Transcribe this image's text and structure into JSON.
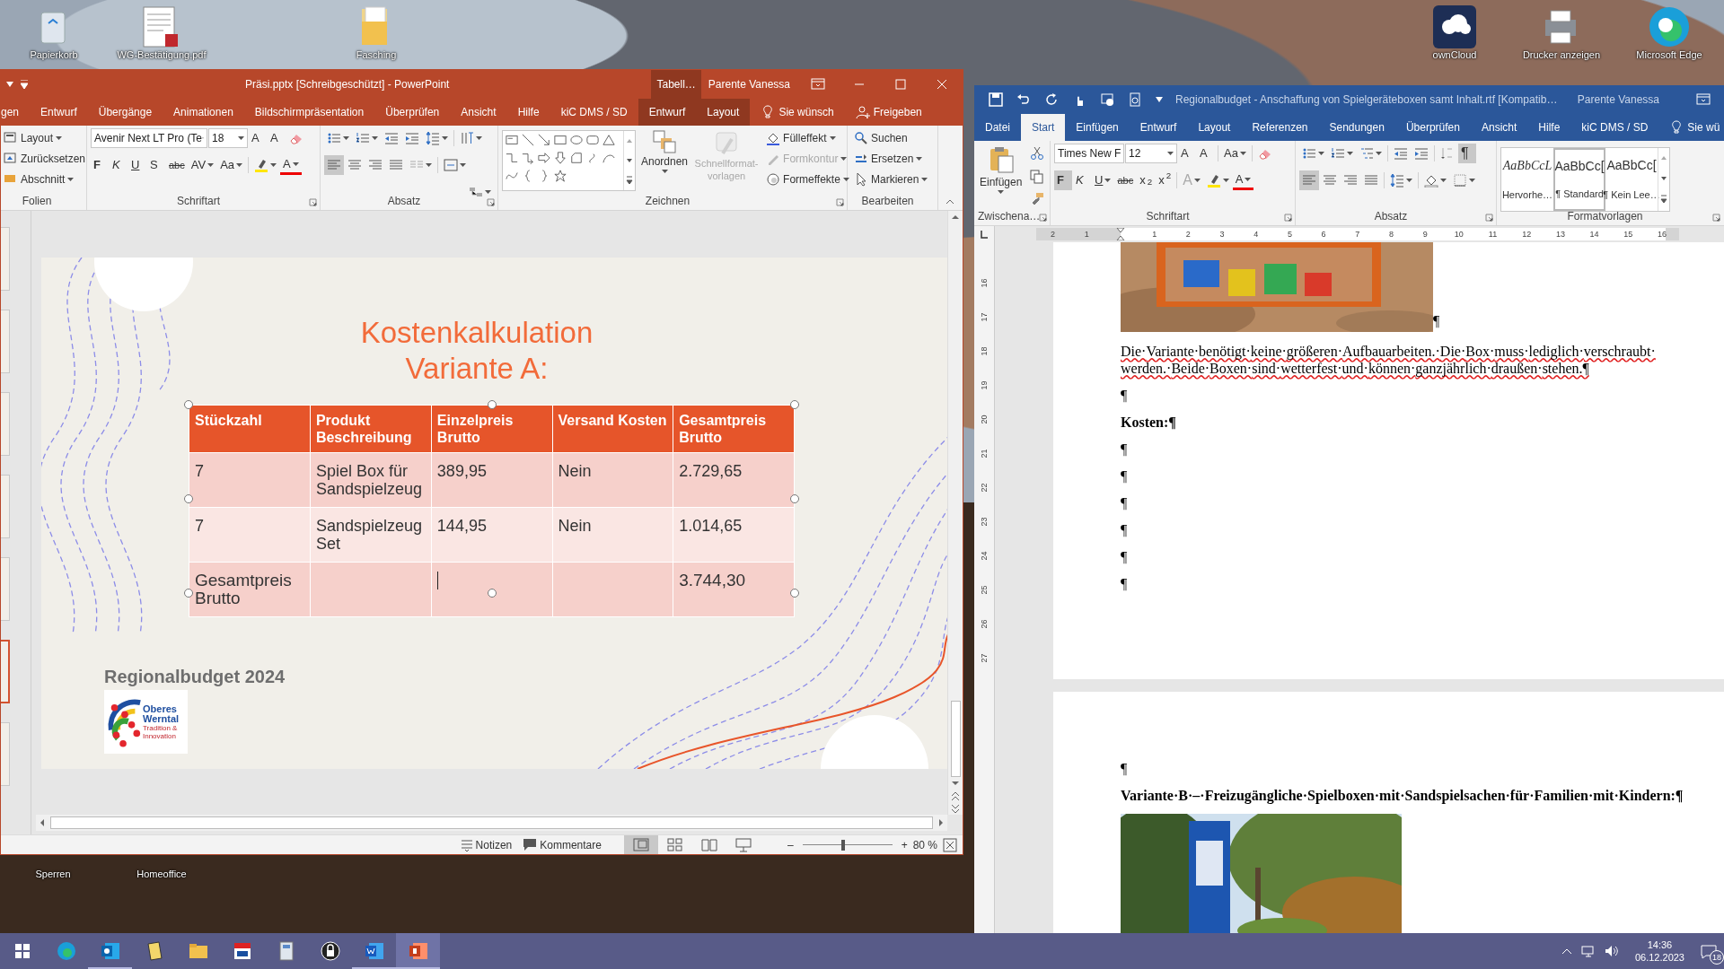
{
  "desktop": {
    "icons": [
      {
        "label": "Papierkorb"
      },
      {
        "label": "WG-Bestätigung.pdf"
      },
      {
        "label": "Fasching"
      },
      {
        "label": "ownCloud"
      },
      {
        "label": "Drucker anzeigen"
      },
      {
        "label": "Microsoft Edge"
      },
      {
        "label": "Sperren"
      },
      {
        "label": "Homeoffice"
      }
    ]
  },
  "powerpoint": {
    "title": "Präsi.pptx [Schreibgeschützt]  -  PowerPoint",
    "context_group": "Tabell…",
    "user": "Parente Vanessa",
    "tabs": [
      {
        "label": "gen",
        "kind": "main",
        "selected": false
      },
      {
        "label": "Entwurf",
        "kind": "main",
        "selected": false
      },
      {
        "label": "Übergänge",
        "kind": "main",
        "selected": false
      },
      {
        "label": "Animationen",
        "kind": "main",
        "selected": false
      },
      {
        "label": "Bildschirmpräsentation",
        "kind": "main",
        "selected": false
      },
      {
        "label": "Überprüfen",
        "kind": "main",
        "selected": false
      },
      {
        "label": "Ansicht",
        "kind": "main",
        "selected": false
      },
      {
        "label": "Hilfe",
        "kind": "main",
        "selected": false
      },
      {
        "label": "kiC DMS / SD",
        "kind": "main",
        "selected": false
      },
      {
        "label": "Entwurf",
        "kind": "context",
        "selected": false
      },
      {
        "label": "Layout",
        "kind": "context",
        "selected": false
      }
    ],
    "tell_me": "Sie wünsch",
    "share": "Freigeben",
    "ribbon": {
      "slides": {
        "label": "Folien",
        "layout": "Layout",
        "reset": "Zurücksetzen",
        "section": "Abschnitt"
      },
      "font": {
        "label": "Schriftart",
        "font_name": "Avenir Next LT Pro (Te",
        "font_size": "18",
        "grow": "A",
        "shrink": "A",
        "format": [
          "F",
          "K",
          "U",
          "S",
          "abc",
          "AV",
          "Aa"
        ],
        "font_color": "A"
      },
      "paragraph": {
        "label": "Absatz",
        "alignment": [
          {
            "selected": true
          },
          {
            "selected": false
          },
          {
            "selected": false
          },
          {
            "selected": false
          }
        ]
      },
      "drawing": {
        "label": "Zeichnen",
        "arrange": "Anordnen",
        "quick_styles": {
          "label": "Schnellformat-vorlagen",
          "disabled": true
        },
        "fill": {
          "label": "Fülleffekt",
          "disabled": false
        },
        "outline": {
          "label": "Formkontur",
          "disabled": true
        },
        "effects": {
          "label": "Formeffekte",
          "disabled": false
        }
      },
      "editing": {
        "label": "Bearbeiten",
        "find": "Suchen",
        "replace": "Ersetzen",
        "select": "Markieren"
      }
    },
    "thumbnails": [
      {
        "selected": false
      },
      {
        "selected": false
      },
      {
        "selected": false
      },
      {
        "selected": false
      },
      {
        "selected": false
      },
      {
        "selected": true
      },
      {
        "selected": false
      }
    ],
    "slide": {
      "title": "Kostenkalkulation Variante A:",
      "table": {
        "selected": true,
        "columns": [
          "Stückzahl",
          "Produkt Beschreibung",
          "Einzelpreis Brutto",
          "Versand Kosten",
          "Gesamtpreis Brutto"
        ],
        "rows": [
          [
            "7",
            "Spiel Box für Sandspielzeug",
            "389,95",
            "Nein",
            "2.729,65"
          ],
          [
            "7",
            "Sandspielzeug Set",
            "144,95",
            "Nein",
            "1.014,65"
          ],
          [
            "Gesamtpreis Brutto",
            null,
            {
              "cursor": true
            },
            null,
            "3.744,30"
          ]
        ]
      },
      "footer": "Regionalbudget 2024",
      "logo": {
        "line1": "Oberes",
        "line2": "Werntal",
        "tagline": "Tradition & Innovation"
      }
    },
    "status_bar": {
      "notes": "Notizen",
      "comments": "Kommentare",
      "views": [
        {
          "selected": true
        },
        {
          "selected": false
        },
        {
          "selected": false
        },
        {
          "selected": false
        }
      ],
      "zoom_out": "–",
      "zoom": {
        "level": 0.45
      },
      "zoom_in": "+",
      "zoom_label": "80 %"
    }
  },
  "word": {
    "title": "Regionalbudget - Anschaffung von Spielgeräteboxen samt Inhalt.rtf [Kompatib…",
    "user": "Parente Vanessa",
    "tabs": [
      {
        "label": "Datei",
        "selected": false
      },
      {
        "label": "Start",
        "selected": true
      },
      {
        "label": "Einfügen",
        "selected": false
      },
      {
        "label": "Entwurf",
        "selected": false
      },
      {
        "label": "Layout",
        "selected": false
      },
      {
        "label": "Referenzen",
        "selected": false
      },
      {
        "label": "Sendungen",
        "selected": false
      },
      {
        "label": "Überprüfen",
        "selected": false
      },
      {
        "label": "Ansicht",
        "selected": false
      },
      {
        "label": "Hilfe",
        "selected": false
      },
      {
        "label": "kiC DMS / SD",
        "selected": false
      }
    ],
    "tell_me": "Sie wü",
    "ribbon": {
      "clipboard": {
        "label": "Zwischena…",
        "paste": "Einfügen"
      },
      "font": {
        "label": "Schriftart",
        "font_name": "Times New F",
        "font_size": "12",
        "grow": "A",
        "shrink": "A",
        "case": "Aa",
        "format": [
          {
            "text": "F",
            "selected": true
          },
          {
            "text": "K",
            "selected": false
          },
          {
            "text": "U",
            "selected": false
          },
          {
            "text": "abc",
            "selected": false
          },
          {
            "text": "x$_{2}$",
            "selected": false
          },
          {
            "text": "x$^{2}$",
            "selected": false
          }
        ],
        "effects": "A",
        "font_color": "A"
      },
      "paragraph": {
        "label": "Absatz",
        "show_marks": {
          "text": "¶",
          "selected": true
        },
        "alignment": [
          {
            "selected": true
          },
          {
            "selected": false
          },
          {
            "selected": false
          },
          {
            "selected": false
          }
        ]
      },
      "styles": {
        "label": "Formatvorlagen",
        "items": [
          {
            "sample": "AaBbCcL",
            "name": "Hervorhe…",
            "selected": false
          },
          {
            "sample": "AaBbCc[",
            "name": "¶ Standard",
            "selected": true
          },
          {
            "sample": "AaBbCc[",
            "name": "¶ Kein Lee…",
            "selected": false
          }
        ]
      }
    },
    "ruler": {
      "horizontal": [
        "2",
        "1",
        "1",
        "2",
        "3",
        "4",
        "5",
        "6",
        "7",
        "8",
        "9",
        "10",
        "11",
        "12",
        "13",
        "14",
        "15",
        "16"
      ],
      "vertical": [
        "16",
        "17",
        "18",
        "19",
        "20",
        "21",
        "22",
        "23",
        "24",
        "25",
        "26",
        "27"
      ]
    },
    "document": [
      {
        "kind": "picture",
        "mark": "¶"
      },
      {
        "kind": "text",
        "text": "Die·Variante·benötigt·keine·größeren·Aufbauarbeiten.·Die·Box·muss·lediglich·verschraubt·werden.·Beide·Boxen·sind·wetterfest·und·können·ganzjährlich·draußen·stehen.¶",
        "spelling_errors": true
      },
      {
        "kind": "text",
        "text": "¶"
      },
      {
        "kind": "heading",
        "text": "Kosten:¶"
      },
      {
        "kind": "text",
        "text": "¶"
      },
      {
        "kind": "text",
        "text": "¶"
      },
      {
        "kind": "text",
        "text": "¶"
      },
      {
        "kind": "text",
        "text": "¶"
      },
      {
        "kind": "text",
        "text": "¶"
      },
      {
        "kind": "text",
        "text": "¶"
      },
      {
        "kind": "page_break"
      },
      {
        "kind": "text",
        "text": "¶"
      },
      {
        "kind": "heading",
        "text": "Variante·B·–·Freizugängliche·Spielboxen·mit·Sandspielsachen·für·Familien·mit·Kindern:¶"
      },
      {
        "kind": "picture"
      }
    ]
  },
  "taskbar": {
    "apps": [
      {
        "selected": false,
        "running": false
      },
      {
        "selected": false,
        "running": true
      },
      {
        "selected": false,
        "running": false
      },
      {
        "selected": false,
        "running": false
      },
      {
        "selected": false,
        "running": false
      },
      {
        "selected": false,
        "running": false
      },
      {
        "selected": false,
        "running": false
      },
      {
        "selected": false,
        "running": true
      },
      {
        "selected": true,
        "running": true
      }
    ],
    "time": "14:36",
    "date": "06.12.2023",
    "notifications": "18"
  }
}
